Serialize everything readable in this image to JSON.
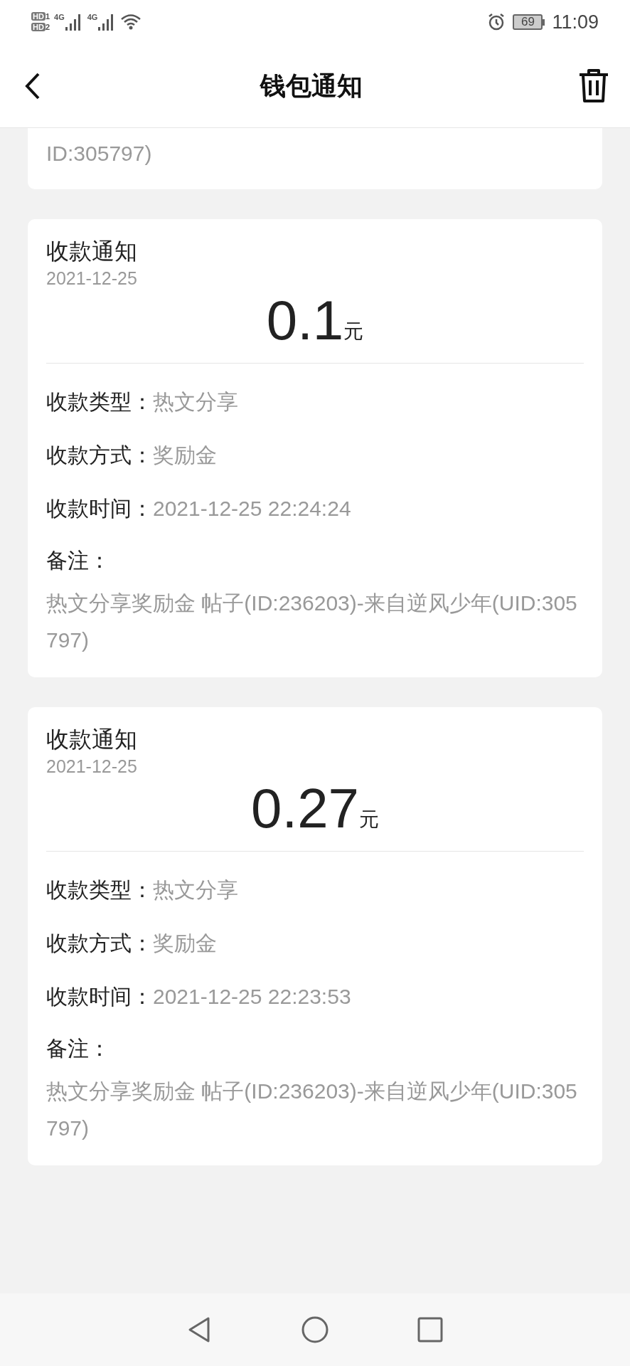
{
  "status_bar": {
    "sims": [
      {
        "hd": "HD",
        "slot": "1",
        "network": "4G"
      },
      {
        "hd": "HD",
        "slot": "2",
        "network": "4G"
      }
    ],
    "battery": "69",
    "time": "11:09"
  },
  "header": {
    "title": "钱包通知"
  },
  "partial_card": {
    "note": "ID:305797)"
  },
  "cards": [
    {
      "title": "收款通知",
      "date": "2021-12-25",
      "amount": "0.1",
      "unit": "元",
      "fields": [
        {
          "label": "收款类型：",
          "value": "热文分享"
        },
        {
          "label": "收款方式：",
          "value": "奖励金"
        },
        {
          "label": "收款时间：",
          "value": "2021-12-25 22:24:24"
        }
      ],
      "note_label": "备注：",
      "note": "热文分享奖励金 帖子(ID:236203)-来自逆风少年(UID:305797)"
    },
    {
      "title": "收款通知",
      "date": "2021-12-25",
      "amount": "0.27",
      "unit": "元",
      "fields": [
        {
          "label": "收款类型：",
          "value": "热文分享"
        },
        {
          "label": "收款方式：",
          "value": "奖励金"
        },
        {
          "label": "收款时间：",
          "value": "2021-12-25 22:23:53"
        }
      ],
      "note_label": "备注：",
      "note": "热文分享奖励金 帖子(ID:236203)-来自逆风少年(UID:305797)"
    }
  ]
}
